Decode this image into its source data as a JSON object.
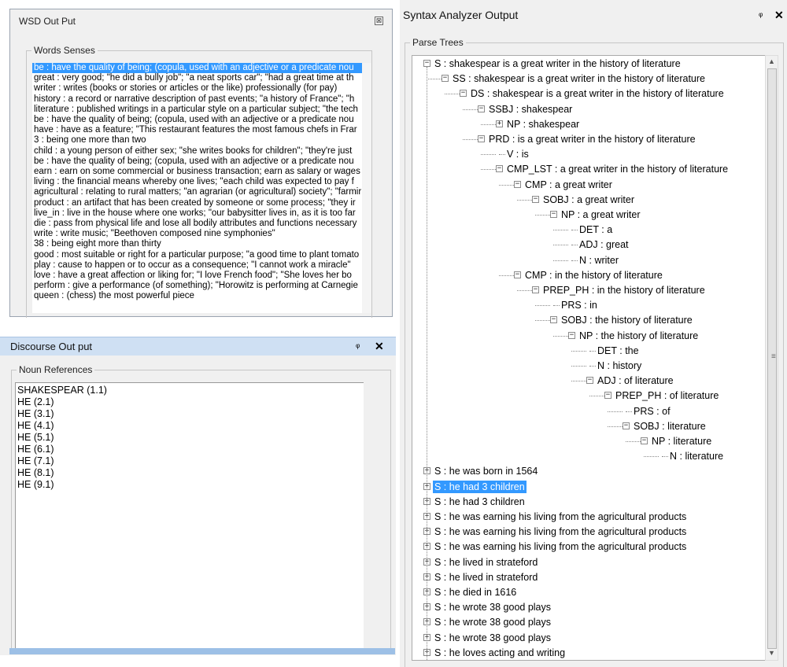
{
  "wsd": {
    "title": "WSD Out Put",
    "close_glyph": "⊠",
    "group_label": "Words Senses",
    "senses": [
      "be :  have the quality of being; (copula, used with an adjective or a predicate nou",
      "great :  very good; \"he did a bully job\"; \"a neat sports car\"; \"had a great time at th",
      "writer :  writes (books or stories or articles or the like) professionally (for pay)",
      "history :  a record or narrative description of past events; \"a history of France\"; \"h",
      "literature :  published writings in a particular style on a particular subject; \"the tech",
      "be :  have the quality of being; (copula, used with an adjective or a predicate nou",
      "have :  have as a feature; \"This restaurant features the most famous chefs in Frar",
      "3 :  being one more than two",
      "child :  a young person of either sex; \"she writes books for children\"; \"they're just",
      "be :  have the quality of being; (copula, used with an adjective or a predicate nou",
      "earn :  earn on some commercial or business transaction; earn as salary or wages",
      "living :  the financial means whereby one lives; \"each child was expected to pay f",
      "agricultural :  relating to rural matters; \"an agrarian (or agricultural) society\"; \"farmir",
      "product :  an artifact that has been created by someone or some process; \"they ir",
      "live_in :  live in the house where one works; \"our babysitter lives in, as it is too far",
      "die :  pass from physical life and lose all bodily attributes and functions necessary",
      "write :  write music; \"Beethoven composed nine symphonies\"",
      "38 :  being eight more than thirty",
      "good :  most suitable or right for a particular purpose; \"a good time to plant tomato",
      "play :  cause to happen or to occur as a consequence; \"I cannot work a miracle\"",
      "love :  have a great affection or liking for; \"I love French food\"; \"She loves her bo",
      "perform :  give a performance (of something); \"Horowitz is performing at Carnegie",
      "queen :  (chess) the most powerful piece"
    ]
  },
  "discourse": {
    "title": "Discourse Out put",
    "pin_glyph": "ᵠ",
    "close_glyph": "✕",
    "group_label": "Noun References",
    "references": [
      "SHAKESPEAR (1.1)",
      "HE (2.1)",
      "HE (3.1)",
      "HE (4.1)",
      "HE (5.1)",
      "HE (6.1)",
      "HE (7.1)",
      "HE (8.1)",
      "HE (9.1)"
    ]
  },
  "syntax": {
    "title": "Syntax Analyzer Output",
    "pin_glyph": "ᵠ",
    "close_glyph": "✕",
    "group_label": "Parse Trees",
    "expanded_tree": [
      {
        "depth": 0,
        "expander": "minus",
        "text": "S :  shakespear is a great writer in the history of literature"
      },
      {
        "depth": 1,
        "expander": "minus",
        "text": "SS :  shakespear is a great writer in the history of literature"
      },
      {
        "depth": 2,
        "expander": "minus",
        "text": "DS :  shakespear is a great writer in the history of literature"
      },
      {
        "depth": 3,
        "expander": "minus",
        "text": "SSBJ :  shakespear"
      },
      {
        "depth": 4,
        "expander": "plus",
        "text": "NP :  shakespear"
      },
      {
        "depth": 3,
        "expander": "minus",
        "text": "PRD :  is a great writer in the history of literature"
      },
      {
        "depth": 4,
        "expander": "none",
        "text": "V :  is"
      },
      {
        "depth": 4,
        "expander": "minus",
        "text": "CMP_LST :  a great writer in the history of literature"
      },
      {
        "depth": 5,
        "expander": "minus",
        "text": "CMP :  a great writer"
      },
      {
        "depth": 6,
        "expander": "minus",
        "text": "SOBJ :  a great writer"
      },
      {
        "depth": 7,
        "expander": "minus",
        "text": "NP :  a great writer"
      },
      {
        "depth": 8,
        "expander": "none",
        "text": "DET :  a"
      },
      {
        "depth": 8,
        "expander": "none",
        "text": "ADJ :  great"
      },
      {
        "depth": 8,
        "expander": "none",
        "text": "N :  writer"
      },
      {
        "depth": 5,
        "expander": "minus",
        "text": "CMP :  in the history of literature"
      },
      {
        "depth": 6,
        "expander": "minus",
        "text": "PREP_PH :  in the history of literature"
      },
      {
        "depth": 7,
        "expander": "none",
        "text": "PRS :  in"
      },
      {
        "depth": 7,
        "expander": "minus",
        "text": "SOBJ :  the history of literature"
      },
      {
        "depth": 8,
        "expander": "minus",
        "text": "NP :  the history of literature"
      },
      {
        "depth": 9,
        "expander": "none",
        "text": "DET :  the"
      },
      {
        "depth": 9,
        "expander": "none",
        "text": "N :  history"
      },
      {
        "depth": 9,
        "expander": "minus",
        "text": "ADJ :  of literature"
      },
      {
        "depth": 10,
        "expander": "minus",
        "text": "PREP_PH :  of literature"
      },
      {
        "depth": 11,
        "expander": "none",
        "text": "PRS :  of"
      },
      {
        "depth": 11,
        "expander": "minus",
        "text": "SOBJ :  literature"
      },
      {
        "depth": 12,
        "expander": "minus",
        "text": "NP :  literature"
      },
      {
        "depth": 13,
        "expander": "none",
        "text": "N :  literature"
      }
    ],
    "collapsed_roots": [
      {
        "text": "S :  he was born in 1564",
        "selected": false
      },
      {
        "text": "S :  he had 3 children",
        "selected": true
      },
      {
        "text": "S :  he had 3 children",
        "selected": false
      },
      {
        "text": "S :  he was earning his living from the agricultural products",
        "selected": false
      },
      {
        "text": "S :  he was earning his living from the agricultural products",
        "selected": false
      },
      {
        "text": "S :  he was earning his living from the agricultural products",
        "selected": false
      },
      {
        "text": "S :  he lived in strateford",
        "selected": false
      },
      {
        "text": "S :  he lived in strateford",
        "selected": false
      },
      {
        "text": "S :  he died in 1616",
        "selected": false
      },
      {
        "text": "S :  he wrote 38 good plays",
        "selected": false
      },
      {
        "text": "S :  he wrote 38 good plays",
        "selected": false
      },
      {
        "text": "S :  he wrote 38 good plays",
        "selected": false
      },
      {
        "text": "S :  he loves acting and writing",
        "selected": false
      }
    ],
    "scroll_up_glyph": "▲",
    "scroll_down_glyph": "▼",
    "scroll_grip_glyph": "≡"
  },
  "colors": {
    "selection": "#3399ff",
    "titlebar": "#cfe0f3",
    "panel_bg": "#f0f0f0"
  }
}
